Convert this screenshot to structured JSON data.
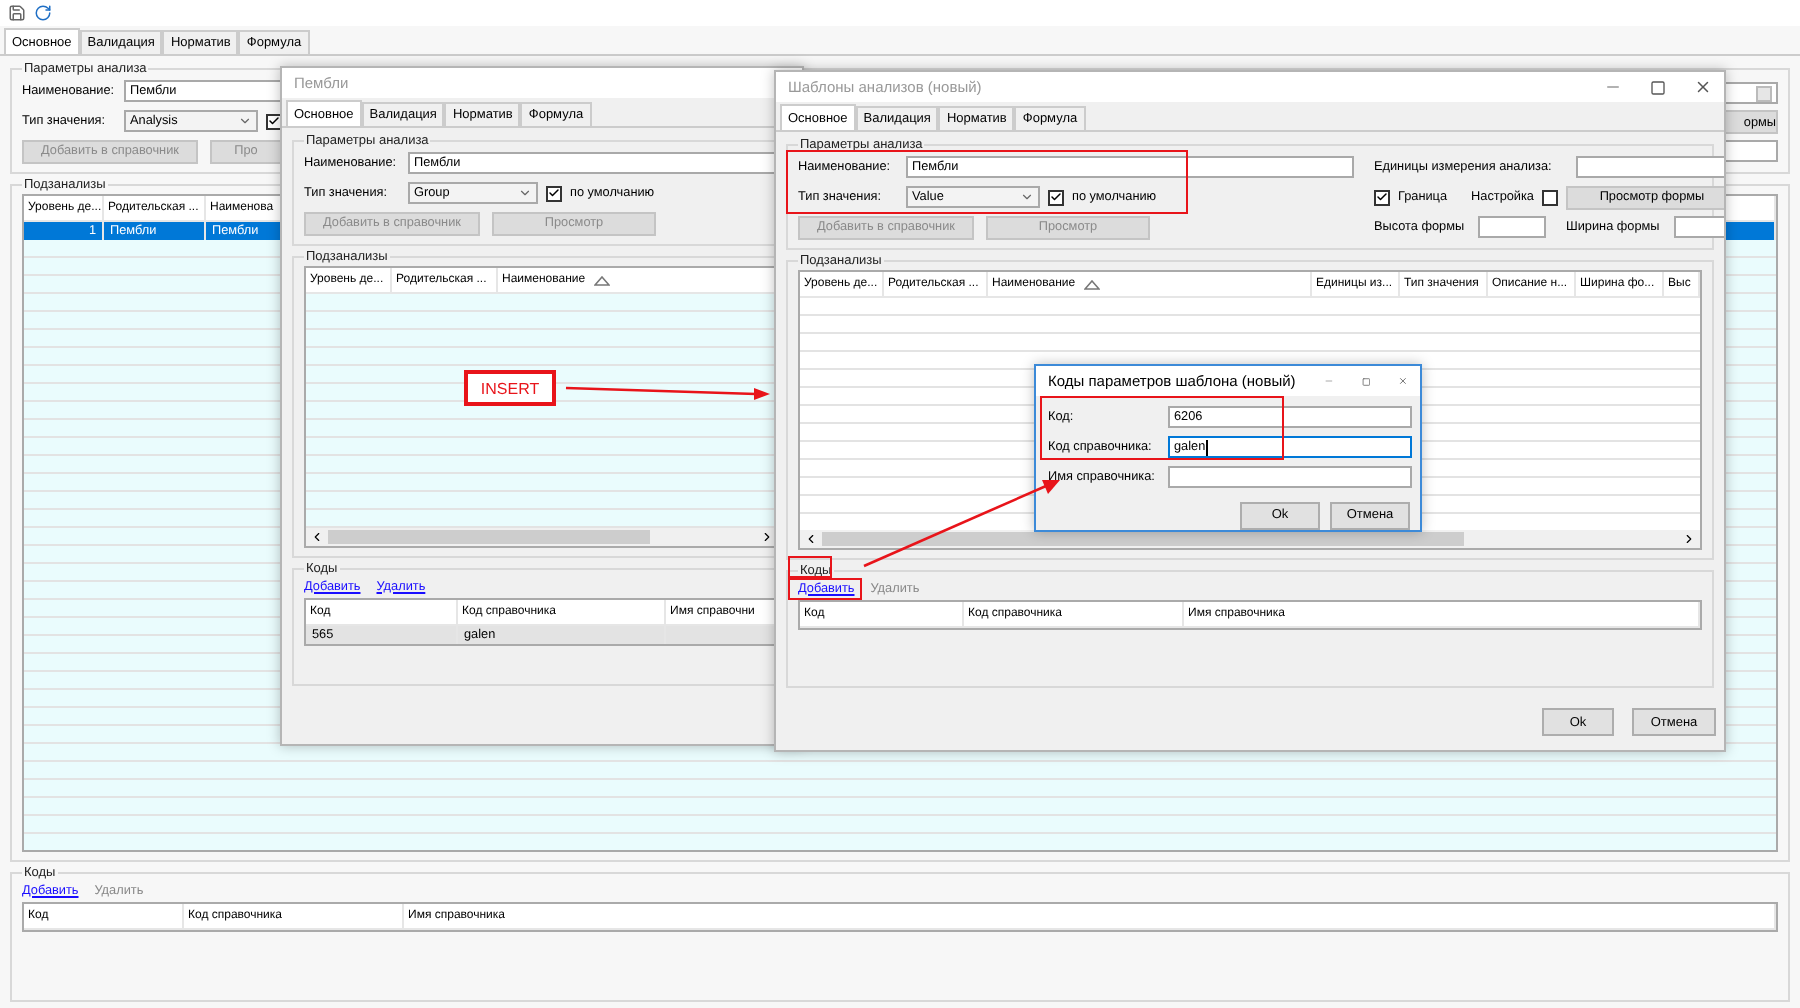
{
  "main_window": {
    "tabs": [
      {
        "label": "Основное",
        "selected": true
      },
      {
        "label": "Валидация",
        "selected": false
      },
      {
        "label": "Норматив",
        "selected": false
      },
      {
        "label": "Формула",
        "selected": false
      }
    ],
    "params": {
      "title": "Параметры анализа",
      "name_label": "Наименование:",
      "name_value": "Пембли",
      "type_label": "Тип значения:",
      "type_value": "Analysis",
      "default_checked": true,
      "buttons": [
        {
          "label": "Добавить в справочник",
          "disabled": true
        },
        {
          "label": "Про",
          "disabled": true
        }
      ],
      "side_button": "ормы"
    },
    "subanalyses": {
      "title": "Подзанализы",
      "focused": true,
      "columns": [
        "Уровень де...",
        "Родительская ...",
        "Наименова"
      ],
      "rows": [
        {
          "cells": [
            "1",
            "Пембли",
            "Пембли"
          ],
          "selected": true
        }
      ]
    },
    "codes": {
      "title": "Коды",
      "links": [
        {
          "label": "Добавить",
          "disabled": false
        },
        {
          "label": "Удалить",
          "disabled": true
        }
      ],
      "columns": [
        "Код",
        "Код справочника",
        "Имя справочника"
      ]
    }
  },
  "dialog_1": {
    "title": "Пембли",
    "active": false,
    "tabs": [
      {
        "label": "Основное",
        "selected": true
      },
      {
        "label": "Валидация",
        "selected": false
      },
      {
        "label": "Норматив",
        "selected": false
      },
      {
        "label": "Формула",
        "selected": false
      }
    ],
    "params": {
      "title": "Параметры анализа",
      "name_label": "Наименование:",
      "name_value": "Пембли",
      "type_label": "Тип значения:",
      "type_value": "Group",
      "default_checked": true,
      "default_label": "по умолчанию",
      "buttons": [
        {
          "label": "Добавить в справочник",
          "disabled": true
        },
        {
          "label": "Просмотр",
          "disabled": true
        }
      ]
    },
    "subanalyses": {
      "title": "Подзанализы",
      "columns": [
        {
          "label": "Уровень де...",
          "sorted": false
        },
        {
          "label": "Родительская ...",
          "sorted": false
        },
        {
          "label": "Наименование",
          "sorted": true
        }
      ]
    },
    "codes": {
      "title": "Коды",
      "links": [
        {
          "label": "Добавить",
          "disabled": false
        },
        {
          "label": "Удалить",
          "disabled": false
        }
      ],
      "focused": false,
      "columns": [
        "Код",
        "Код справочника",
        "Имя справочни"
      ],
      "rows": [
        {
          "cells": [
            "565",
            "galen"
          ],
          "selected": true
        }
      ]
    }
  },
  "dialog_2": {
    "title": "Шаблоны анализов (новый)",
    "active": false,
    "tabs": [
      {
        "label": "Основное",
        "selected": true
      },
      {
        "label": "Валидация",
        "selected": false
      },
      {
        "label": "Норматив",
        "selected": false
      },
      {
        "label": "Формула",
        "selected": false
      }
    ],
    "params": {
      "title": "Параметры анализа",
      "name_label": "Наименование:",
      "name_value": "Пембли",
      "type_label": "Тип значения:",
      "type_value": "Value",
      "default_checked": true,
      "default_label": "по умолчанию",
      "buttons": [
        {
          "label": "Добавить в справочник",
          "disabled": true
        },
        {
          "label": "Просмотр",
          "disabled": true
        }
      ],
      "units_label": "Единицы измерения анализа:",
      "border_label": "Граница",
      "border_checked": true,
      "setup_label": "Настройка",
      "setup_checked": false,
      "preview_button": "Просмотр формы",
      "height_label": "Высота формы",
      "width_label": "Ширина формы"
    },
    "subanalyses": {
      "title": "Подзанализы",
      "columns": [
        {
          "label": "Уровень де...",
          "sorted": false
        },
        {
          "label": "Родительская ...",
          "sorted": false
        },
        {
          "label": "Наименование",
          "sorted": true
        },
        {
          "label": "Единицы из...",
          "sorted": false
        },
        {
          "label": "Тип значения",
          "sorted": false
        },
        {
          "label": "Описание н...",
          "sorted": false
        },
        {
          "label": "Ширина фо...",
          "sorted": false
        },
        {
          "label": "Выс",
          "sorted": false
        }
      ]
    },
    "codes": {
      "title": "Коды",
      "links": [
        {
          "label": "Добавить",
          "disabled": false
        },
        {
          "label": "Удалить",
          "disabled": true
        }
      ],
      "columns": [
        "Код",
        "Код справочника",
        "Имя справочника"
      ]
    },
    "footer_buttons": [
      "Ok",
      "Отмена"
    ]
  },
  "dialog_3": {
    "title": "Коды параметров шаблона (новый)",
    "active": true,
    "fields": [
      {
        "label": "Код:",
        "value": "6206",
        "focused": false
      },
      {
        "label": "Код справочника:",
        "value": "galen",
        "focused": true
      },
      {
        "label": "Имя справочника:",
        "focused": false
      }
    ],
    "buttons": [
      "Ok",
      "Отмена"
    ]
  },
  "annotation": {
    "label": "INSERT"
  }
}
